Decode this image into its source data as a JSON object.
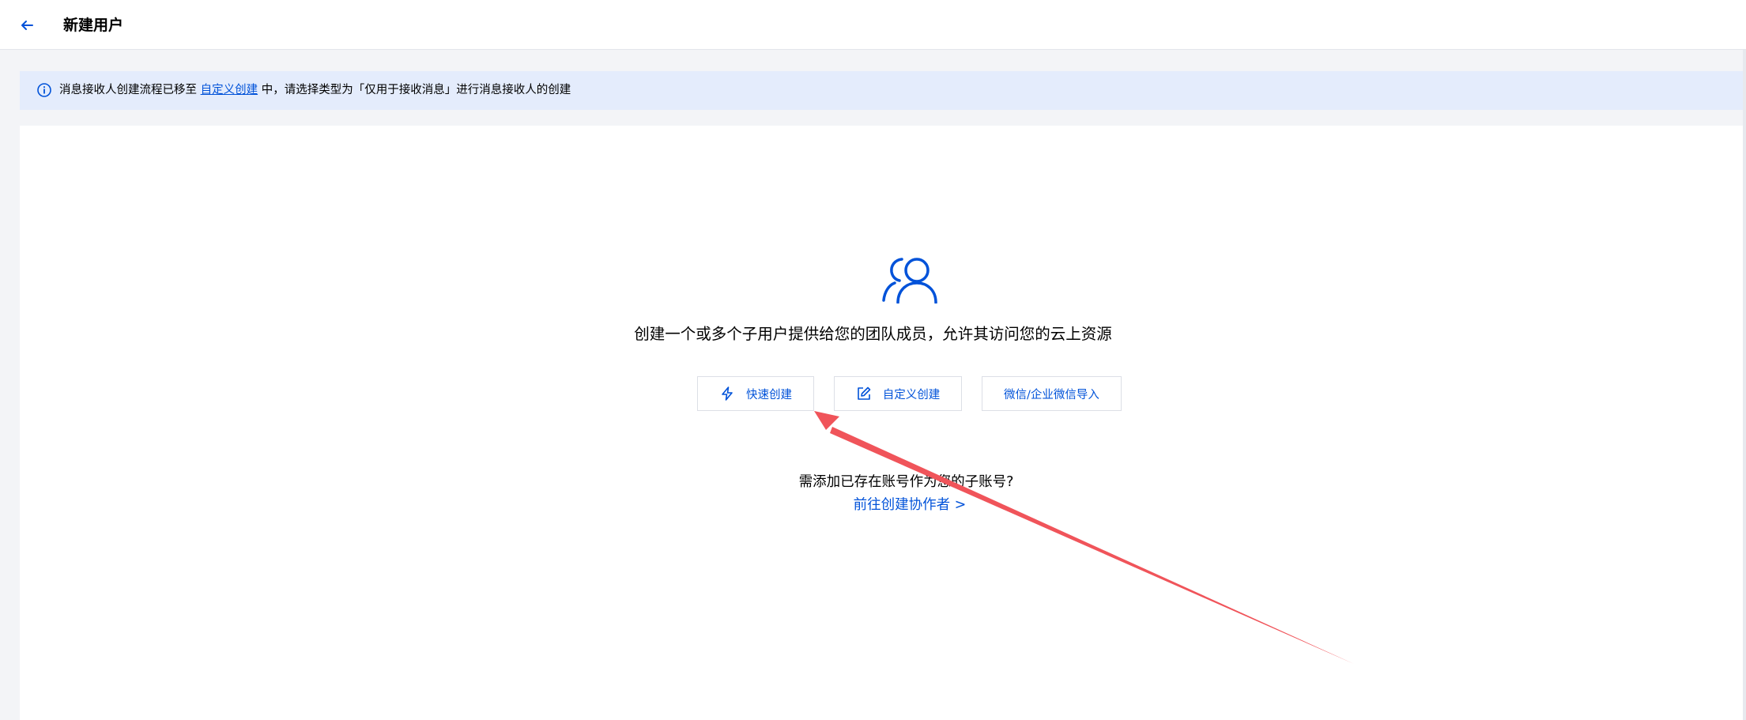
{
  "header": {
    "back_icon": "arrow-left-icon",
    "title": "新建用户"
  },
  "notice": {
    "icon": "info-circle-icon",
    "text_before": "消息接收人创建流程已移至",
    "link_label": "自定义创建",
    "text_after": "中，请选择类型为「仅用于接收消息」进行消息接收人的创建"
  },
  "main": {
    "hero_icon": "users-icon",
    "description": "创建一个或多个子用户提供给您的团队成员，允许其访问您的云上资源",
    "buttons": {
      "quick_create": {
        "label": "快速创建",
        "icon": "lightning-icon"
      },
      "custom_create": {
        "label": "自定义创建",
        "icon": "edit-icon"
      },
      "wechat_import": {
        "label": "微信/企业微信导入"
      }
    },
    "existing_account_question": "需添加已存在账号作为您的子账号?",
    "collaborator_link": "前往创建协作者 >"
  },
  "annotation": {
    "arrow_color": "#f0545a"
  },
  "colors": {
    "accent": "#0052d9",
    "notice_bg": "#e4ecfc",
    "page_bg": "#f3f4f7"
  }
}
